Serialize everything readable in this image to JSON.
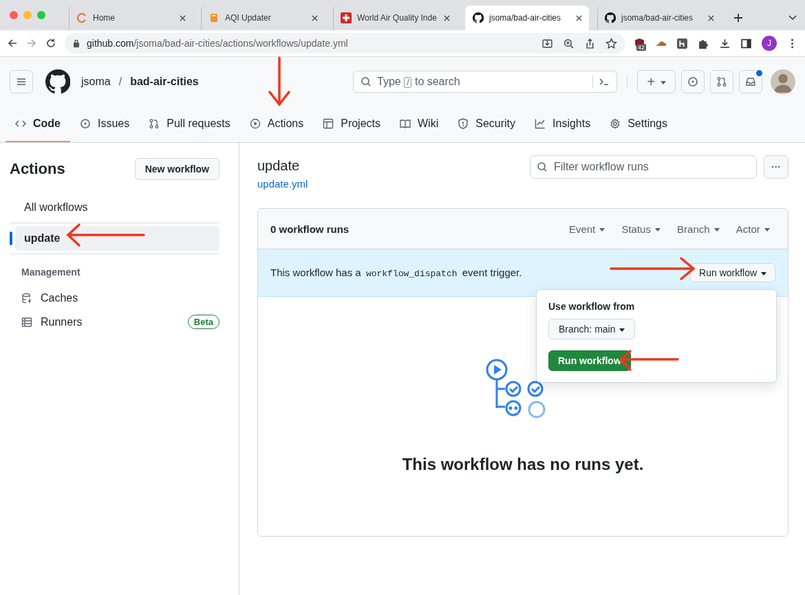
{
  "browser": {
    "tabs": [
      {
        "title": "Home",
        "selected": false
      },
      {
        "title": "AQI Updater",
        "selected": false
      },
      {
        "title": "World Air Quality Inde",
        "selected": false
      },
      {
        "title": "jsoma/bad-air-cities",
        "selected": true
      },
      {
        "title": "jsoma/bad-air-cities",
        "selected": false
      }
    ],
    "url": {
      "domain": "github.com",
      "path": "/jsoma/bad-air-cities/actions/workflows/update.yml"
    },
    "extension_badge": "42",
    "profile": "J"
  },
  "header": {
    "owner": "jsoma",
    "separator": "/",
    "repo": "bad-air-cities",
    "search": {
      "before": "Type",
      "key": "/",
      "after": "to search"
    },
    "plus": "+"
  },
  "repo_tabs": [
    {
      "label": "Code",
      "selected": true
    },
    {
      "label": "Issues",
      "selected": false
    },
    {
      "label": "Pull requests",
      "selected": false
    },
    {
      "label": "Actions",
      "selected": false
    },
    {
      "label": "Projects",
      "selected": false
    },
    {
      "label": "Wiki",
      "selected": false
    },
    {
      "label": "Security",
      "selected": false
    },
    {
      "label": "Insights",
      "selected": false
    },
    {
      "label": "Settings",
      "selected": false
    }
  ],
  "sidebar": {
    "title": "Actions",
    "new_button": "New workflow",
    "workflows": [
      {
        "label": "All workflows",
        "selected": false
      },
      {
        "label": "update",
        "selected": true
      }
    ],
    "section": "Management",
    "management": [
      {
        "label": "Caches"
      },
      {
        "label": "Runners",
        "badge": "Beta"
      }
    ]
  },
  "main": {
    "title": "update",
    "file": "update.yml",
    "filter": {
      "placeholder": "Filter workflow runs"
    },
    "more": "···",
    "runs": {
      "count": "0 workflow runs",
      "filters": [
        "Event",
        "Status",
        "Branch",
        "Actor"
      ],
      "banner": {
        "before": "This workflow has a",
        "code": "workflow_dispatch",
        "after": "event trigger.",
        "button": "Run workflow"
      },
      "popover": {
        "heading": "Use workflow from",
        "branch": "Branch: main",
        "run": "Run workflow"
      },
      "empty": "This workflow has no runs yet."
    }
  }
}
